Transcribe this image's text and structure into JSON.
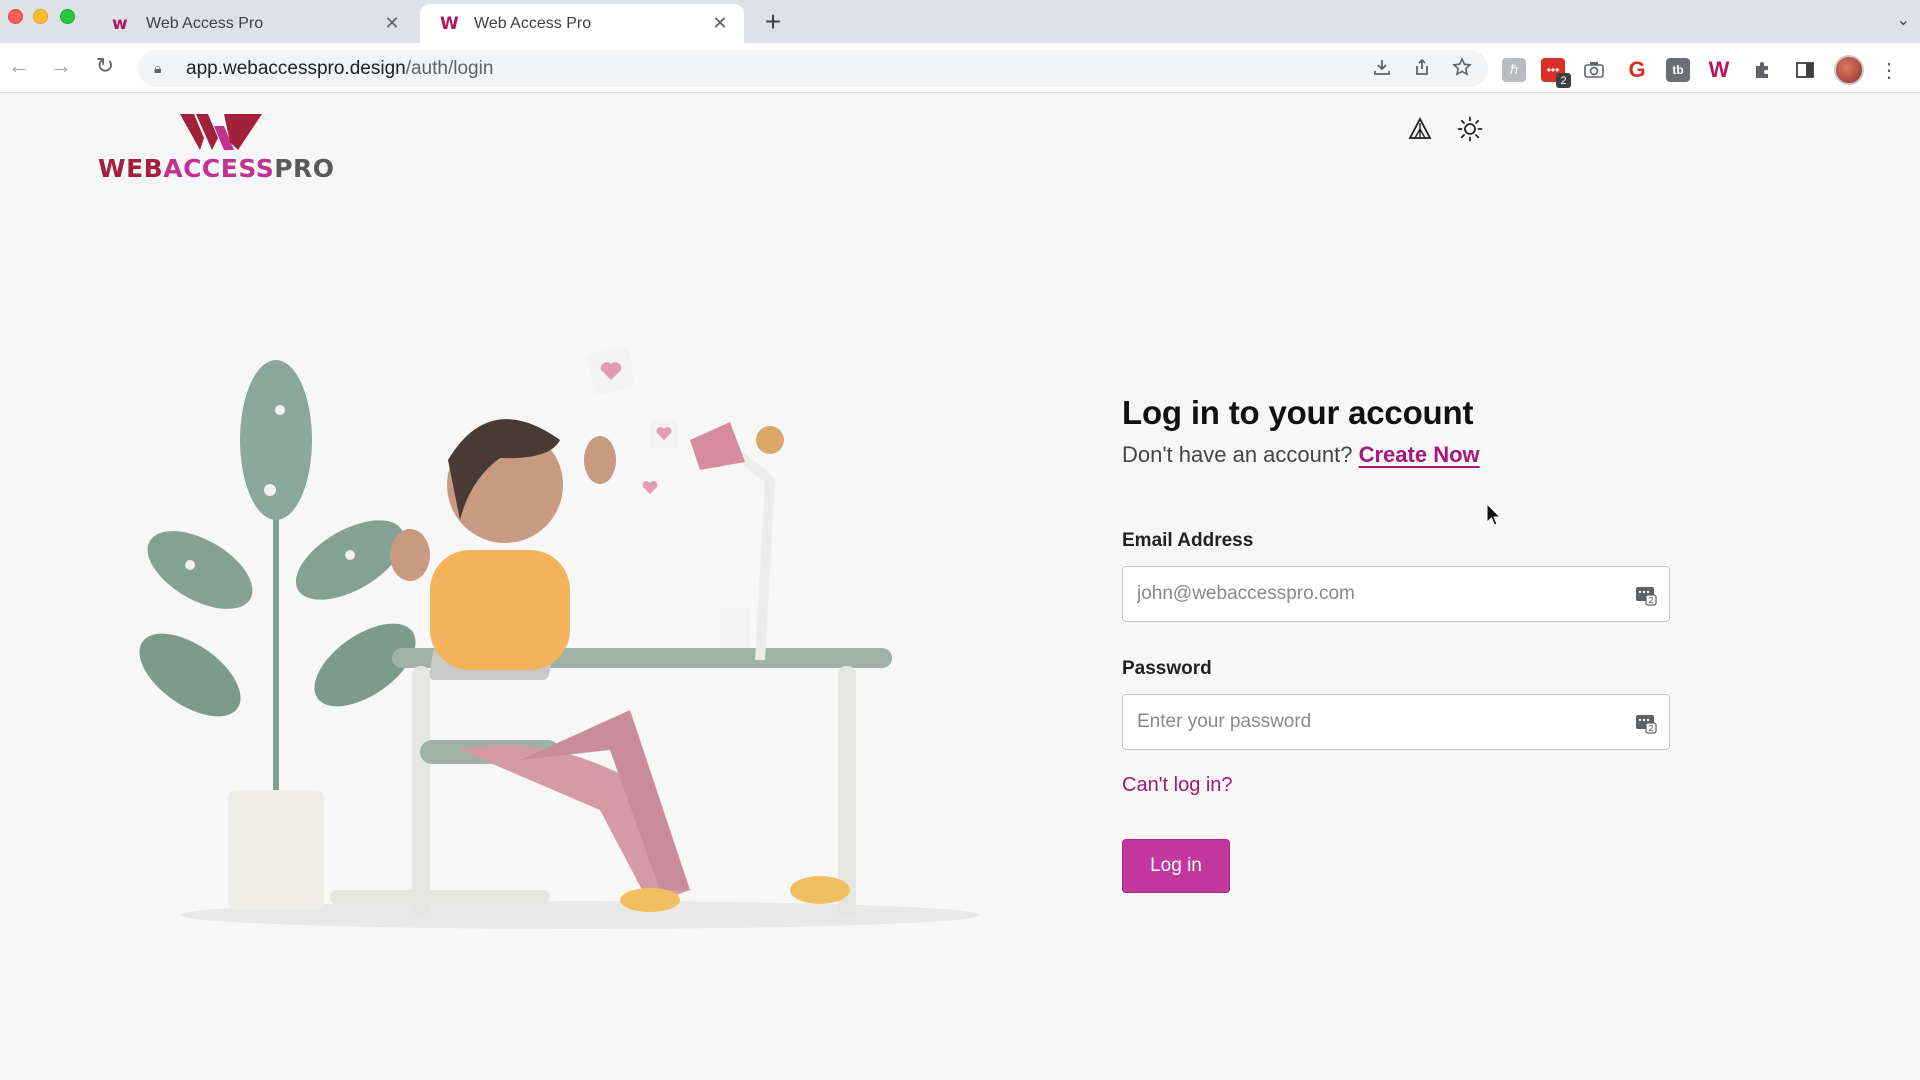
{
  "browser": {
    "tabs": [
      {
        "title": "Web Access Pro",
        "favicon": "w-logo-icon",
        "active": false
      },
      {
        "title": "Web Access Pro",
        "favicon": "w-logo-icon",
        "active": true
      }
    ],
    "url_host": "app.webaccesspro.design",
    "url_path": "/auth/login",
    "extension_badge_count": "2"
  },
  "brand": {
    "logo_parts": [
      "WEB",
      "ACCESS",
      "PRO"
    ],
    "colors": {
      "primary": "#c2389f",
      "link": "#a3187a",
      "logo_red": "#a1203a"
    }
  },
  "header": {
    "icons": [
      "accessibility-triangle-icon",
      "sun-theme-icon"
    ]
  },
  "login": {
    "heading": "Log in to your account",
    "subtext": "Don't have an account?",
    "create_link": "Create Now",
    "email_label": "Email Address",
    "email_placeholder": "john@webaccesspro.com",
    "password_label": "Password",
    "password_placeholder": "Enter your password",
    "forgot_link": "Can't log in?",
    "submit_label": "Log in"
  }
}
